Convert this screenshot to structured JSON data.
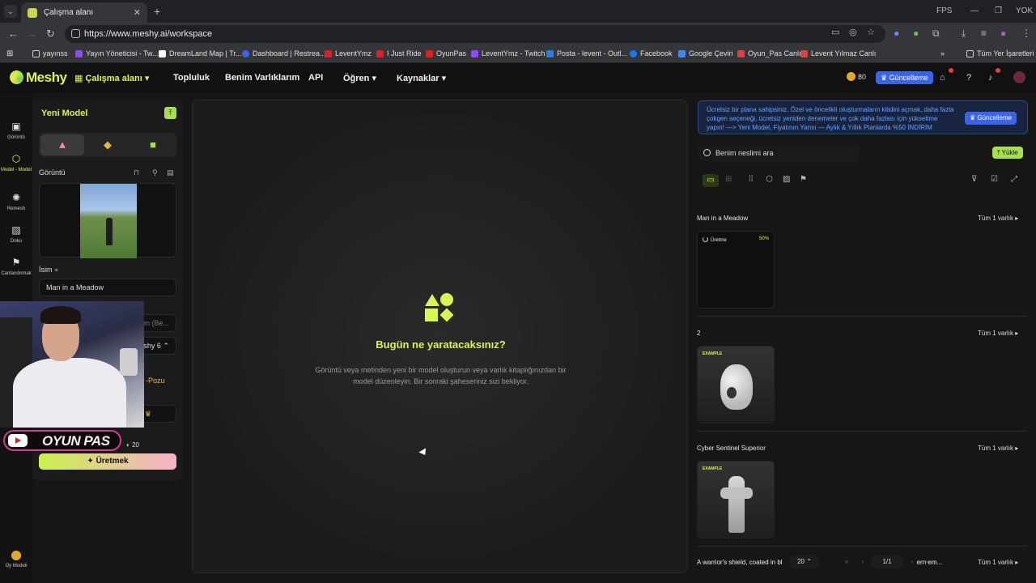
{
  "browser": {
    "tab_title": "Çalışma alanı",
    "url": "https://www.meshy.ai/workspace",
    "fps_label": "FPS",
    "profile_label": "YOK",
    "bookmarks": [
      "yayınss",
      "Yayın Yöneticisi - Tw...",
      "DreamLand Map | Tr...",
      "Dashboard | Restrea...",
      "LeventYmz",
      "I Just Ride",
      "OyunPas",
      "LeventYmz - Twitch",
      "Posta - levent - Outl...",
      "Facebook",
      "Google Çeviri",
      "Oyun_Pas Canlı",
      "Levent Yılmaz Canlı"
    ],
    "bookmarks_all": "Tüm Yer İşaretleri"
  },
  "header": {
    "logo": "Meshy",
    "nav": [
      "Çalışma alanı",
      "Topluluk",
      "Benim Varlıklarım",
      "API",
      "Öğren",
      "Kaynaklar"
    ],
    "credits": "80",
    "upgrade": "Güncelleme"
  },
  "rail": {
    "items": [
      "Görüntü",
      "Model - Model",
      "Remesh",
      "Doku",
      "Canlandırmak"
    ],
    "bottom": "Oy Modeli"
  },
  "left_panel": {
    "title": "Yeni Model",
    "image_label": "Görüntü",
    "name_label": "İsim",
    "name_value": "Man in a Meadow",
    "partial_1": "gon (Be...",
    "partial_2": "eshy 6",
    "partial_3": "-Pozu",
    "credit_cost": "20",
    "generate": "Üretmek"
  },
  "overlay": {
    "channel": "OYUN PAS"
  },
  "canvas": {
    "title": "Bugün ne yaratacaksınız?",
    "subtitle": "Görüntü veya metinden yeni bir model oluşturun veya varlık kitaplığınızdan bir model düzenleyin. Bir sonraki şaheseriniz sizi bekliyor."
  },
  "right_panel": {
    "banner": "Ücretsiz bir plana sahipsiniz. Özel ve öncelikli oluşturmaların kilidini açmak, daha fazla çokgen seçeneği, ücretsiz yeniden denemeler ve çok daha fazlası için yükseltme yapın! —> Yeni Model, Fiyatının Yarısı — Aylık & Yıllık Planlarda %50 İNDİRİM",
    "banner_button": "Güncelleme",
    "search_placeholder": "Benim neslimi ara",
    "upload": "Yükle",
    "sections": [
      {
        "title": "Man in a Meadow",
        "all": "Tüm 1 varlık",
        "status": "Üretme",
        "progress": "50%"
      },
      {
        "title": "2",
        "all": "Tüm 1 varlık",
        "badge": "EXAMPLE"
      },
      {
        "title": "Cyber Sentinel Superior",
        "all": "Tüm 1 varlık",
        "badge": "EXAMPLE"
      },
      {
        "title": "A warrior's shield, coated in bl",
        "title_tail": "ern em...",
        "all": "Tüm 1 varlık"
      }
    ],
    "page_size": "20",
    "page": "1/1"
  }
}
